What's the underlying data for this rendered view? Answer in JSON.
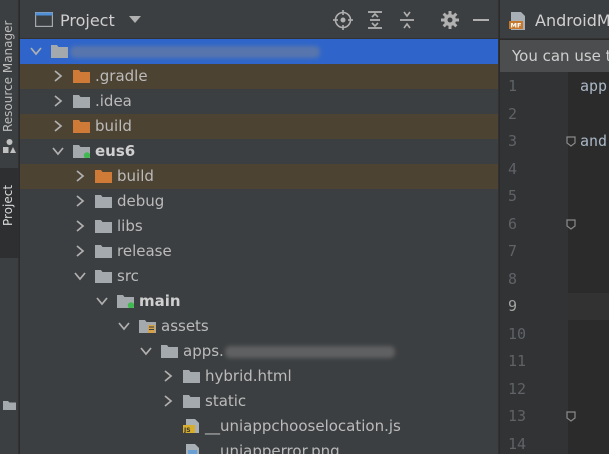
{
  "strip": {
    "resource_manager_label": "Resource Manager",
    "project_label": "Project"
  },
  "panel": {
    "title": "Project",
    "header_icons": [
      "locate-icon",
      "expand-all-icon",
      "collapse-all-icon",
      "gear-icon",
      "minimize-icon"
    ]
  },
  "tree": [
    {
      "label": "",
      "depth": 0,
      "expanded": true,
      "selected": true,
      "icon": "project-folder-icon"
    },
    {
      "label": ".gradle",
      "depth": 1,
      "expanded": false,
      "excluded": true,
      "icon": "orange-folder-icon"
    },
    {
      "label": ".idea",
      "depth": 1,
      "expanded": false,
      "icon": "folder-icon"
    },
    {
      "label": "build",
      "depth": 1,
      "expanded": false,
      "excluded": true,
      "icon": "orange-folder-icon"
    },
    {
      "label": "eus6",
      "depth": 1,
      "expanded": true,
      "bold": true,
      "icon": "module-folder-icon"
    },
    {
      "label": "build",
      "depth": 2,
      "expanded": false,
      "excluded": true,
      "icon": "orange-folder-icon"
    },
    {
      "label": "debug",
      "depth": 2,
      "expanded": false,
      "icon": "folder-icon"
    },
    {
      "label": "libs",
      "depth": 2,
      "expanded": false,
      "icon": "folder-icon"
    },
    {
      "label": "release",
      "depth": 2,
      "expanded": false,
      "icon": "folder-icon"
    },
    {
      "label": "src",
      "depth": 2,
      "expanded": true,
      "icon": "folder-icon"
    },
    {
      "label": "main",
      "depth": 3,
      "expanded": true,
      "bold": true,
      "icon": "source-folder-icon"
    },
    {
      "label": "assets",
      "depth": 4,
      "expanded": true,
      "icon": "assets-folder-icon"
    },
    {
      "label": "apps.",
      "depth": 5,
      "expanded": true,
      "icon": "folder-icon"
    },
    {
      "label": "hybrid.html",
      "depth": 6,
      "expanded": false,
      "icon": "folder-icon"
    },
    {
      "label": "static",
      "depth": 6,
      "expanded": false,
      "icon": "folder-icon"
    },
    {
      "label": "__uniappchooselocation.js",
      "depth": 6,
      "leaf": true,
      "icon": "js-file-icon"
    },
    {
      "label": "__uniapperror.png",
      "depth": 6,
      "leaf": true,
      "icon": "image-file-icon"
    }
  ],
  "editor": {
    "tab_label": "AndroidM",
    "notice": "You can use t",
    "line_numbers": [
      "1",
      "2",
      "3",
      "4",
      "5",
      "6",
      "7",
      "8",
      "9",
      "10",
      "11",
      "12",
      "13",
      "14"
    ],
    "active_line": "9",
    "code_lines": [
      {
        "line": "1",
        "text": "app"
      },
      {
        "line": "3",
        "text": "and"
      }
    ]
  },
  "colors": {
    "panel_bg": "#3c3f41",
    "editor_bg": "#2b2b2b",
    "selection": "#2f65ca",
    "excluded_row": "#4d4333",
    "folder_orange": "#d07a38",
    "folder_gray": "#a3a9ad",
    "module_dot": "#3fb950"
  }
}
